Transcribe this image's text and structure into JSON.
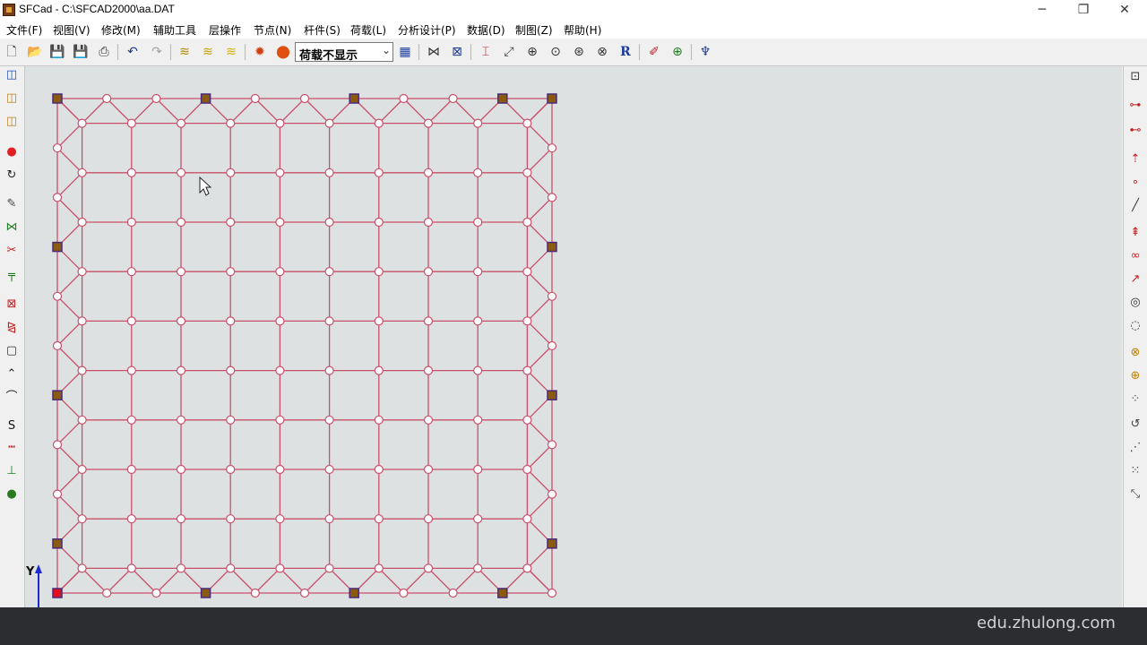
{
  "window": {
    "title": "SFCad - C:\\SFCAD2000\\aa.DAT",
    "minimize_glyph": "─",
    "restore_glyph": "❐",
    "close_glyph": "✕"
  },
  "menu": [
    {
      "label": "文件(F)"
    },
    {
      "label": "视图(V)"
    },
    {
      "label": "修改(M)"
    },
    {
      "label": "辅助工具"
    },
    {
      "label": "层操作"
    },
    {
      "label": "节点(N)"
    },
    {
      "label": "杆件(S)"
    },
    {
      "label": "荷载(L)"
    },
    {
      "label": "分析设计(P)"
    },
    {
      "label": "数据(D)"
    },
    {
      "label": "制图(Z)"
    },
    {
      "label": "帮助(H)"
    }
  ],
  "toolbar": {
    "buttons": [
      {
        "name": "new-file-icon",
        "glyph": "🗋",
        "color": "#333333"
      },
      {
        "name": "open-folder-icon",
        "glyph": "📂",
        "color": "#c89a20"
      },
      {
        "name": "save-icon",
        "glyph": "💾",
        "color": "#1a2a80"
      },
      {
        "name": "save-as-icon",
        "glyph": "💾",
        "color": "#3060b0"
      },
      {
        "name": "print-icon",
        "glyph": "⎙",
        "color": "#333333"
      },
      {
        "name": "undo-icon",
        "glyph": "↶",
        "color": "#1a3a90"
      },
      {
        "name": "redo-icon",
        "glyph": "↷",
        "color": "#a0a0a0"
      },
      {
        "name": "layer-1-icon",
        "glyph": "≋",
        "color": "#b08a00"
      },
      {
        "name": "layer-2-icon",
        "glyph": "≋",
        "color": "#c8a000"
      },
      {
        "name": "layer-3-icon",
        "glyph": "≋",
        "color": "#d4b000"
      },
      {
        "name": "load-flame-icon",
        "glyph": "✹",
        "color": "#d04010"
      },
      {
        "name": "load-drop-icon",
        "glyph": "⬤",
        "color": "#e05010"
      },
      {
        "name": "grid-table-icon",
        "glyph": "▦",
        "color": "#2040a0"
      },
      {
        "name": "truss-icon",
        "glyph": "⋈",
        "color": "#333333"
      },
      {
        "name": "member-icon",
        "glyph": "⊠",
        "color": "#1a3a90"
      },
      {
        "name": "i-beam-icon",
        "glyph": "⌶",
        "color": "#c02020"
      },
      {
        "name": "zoom-window-icon",
        "glyph": "⤢",
        "color": "#444444"
      },
      {
        "name": "zoom-in-icon",
        "glyph": "⊕",
        "color": "#333333"
      },
      {
        "name": "zoom-icon",
        "glyph": "⊙",
        "color": "#333333"
      },
      {
        "name": "zoom-all-icon",
        "glyph": "⊛",
        "color": "#333333"
      },
      {
        "name": "zoom-previous-icon",
        "glyph": "⊗",
        "color": "#333333"
      },
      {
        "name": "redraw-icon",
        "glyph": "R",
        "color": "#1a3aa0"
      },
      {
        "name": "measure-icon",
        "glyph": "✐",
        "color": "#c02020"
      },
      {
        "name": "target-icon",
        "glyph": "⊕",
        "color": "#208020"
      },
      {
        "name": "support-icon",
        "glyph": "♆",
        "color": "#1a3a90"
      }
    ],
    "load_display": {
      "value": "荷载不显示",
      "arrow": "⌄"
    }
  },
  "left_toolbar": [
    {
      "name": "view-xy-icon",
      "glyph": "◫",
      "color": "#2050c0"
    },
    {
      "name": "view-xz-icon",
      "glyph": "◫",
      "color": "#c08020"
    },
    {
      "name": "view-yz-icon",
      "glyph": "◫",
      "color": "#c08020"
    },
    {
      "name": "node-dot-icon",
      "glyph": "●",
      "color": "#e02020"
    },
    {
      "name": "rotate-icon",
      "glyph": "↻",
      "color": "#222222"
    },
    {
      "name": "pen-icon",
      "glyph": "✎",
      "color": "#444444"
    },
    {
      "name": "link-icon",
      "glyph": "⋈",
      "color": "#208020"
    },
    {
      "name": "cut-icon",
      "glyph": "✂",
      "color": "#c02020"
    },
    {
      "name": "add-member-icon",
      "glyph": "╤",
      "color": "#208020"
    },
    {
      "name": "delete-box-icon",
      "glyph": "⊠",
      "color": "#c02020"
    },
    {
      "name": "mirror-icon",
      "glyph": "⧎",
      "color": "#c02020"
    },
    {
      "name": "rectangle-icon",
      "glyph": "▢",
      "color": "#333333"
    },
    {
      "name": "arch-icon",
      "glyph": "⌃",
      "color": "#222222"
    },
    {
      "name": "arch-2-icon",
      "glyph": "⌒",
      "color": "#222222"
    },
    {
      "name": "section-s-icon",
      "glyph": "S",
      "color": "#111111"
    },
    {
      "name": "ruler-icon",
      "glyph": "┅",
      "color": "#c02020"
    },
    {
      "name": "support-base-icon",
      "glyph": "⊥",
      "color": "#208020"
    },
    {
      "name": "sphere-icon",
      "glyph": "●",
      "color": "#2a7a20"
    }
  ],
  "right_toolbar": [
    {
      "name": "zoom-extent-icon",
      "glyph": "⊡",
      "color": "#333333"
    },
    {
      "name": "node-arrow-icon",
      "glyph": "⊶",
      "color": "#c02020"
    },
    {
      "name": "node-arrow-2-icon",
      "glyph": "⊷",
      "color": "#c02020"
    },
    {
      "name": "node-up-icon",
      "glyph": "⇡",
      "color": "#c02020"
    },
    {
      "name": "node-chain-icon",
      "glyph": "∘",
      "color": "#c02020"
    },
    {
      "name": "line-icon",
      "glyph": "╱",
      "color": "#333333"
    },
    {
      "name": "node-stack-icon",
      "glyph": "⇞",
      "color": "#c02020"
    },
    {
      "name": "node-pair-icon",
      "glyph": "∞",
      "color": "#c02020"
    },
    {
      "name": "node-diagonal-icon",
      "glyph": "↗",
      "color": "#c02020"
    },
    {
      "name": "circle-node-icon",
      "glyph": "◎",
      "color": "#333333"
    },
    {
      "name": "circle-node-2-icon",
      "glyph": "◌",
      "color": "#333333"
    },
    {
      "name": "delete-node-icon",
      "glyph": "⊗",
      "color": "#c08000"
    },
    {
      "name": "add-node-icon",
      "glyph": "⊕",
      "color": "#c08000"
    },
    {
      "name": "node-grid-icon",
      "glyph": "⁘",
      "color": "#444444"
    },
    {
      "name": "node-rotate-icon",
      "glyph": "↺",
      "color": "#444444"
    },
    {
      "name": "node-line-icon",
      "glyph": "⋰",
      "color": "#444444"
    },
    {
      "name": "node-ring-icon",
      "glyph": "⁙",
      "color": "#444444"
    },
    {
      "name": "node-break-icon",
      "glyph": "⤡",
      "color": "#444444"
    }
  ],
  "canvas": {
    "axis_label": "Y",
    "colors": {
      "member": "#c8506a",
      "node_fill": "#ffffff",
      "support_fill": "#8a5a10",
      "support_border": "#4a2a7a",
      "origin_support_fill": "#e01020",
      "axis": "#1a2ad0",
      "background": "#dde1e2"
    }
  },
  "watermark": "edu.zhulong.com"
}
